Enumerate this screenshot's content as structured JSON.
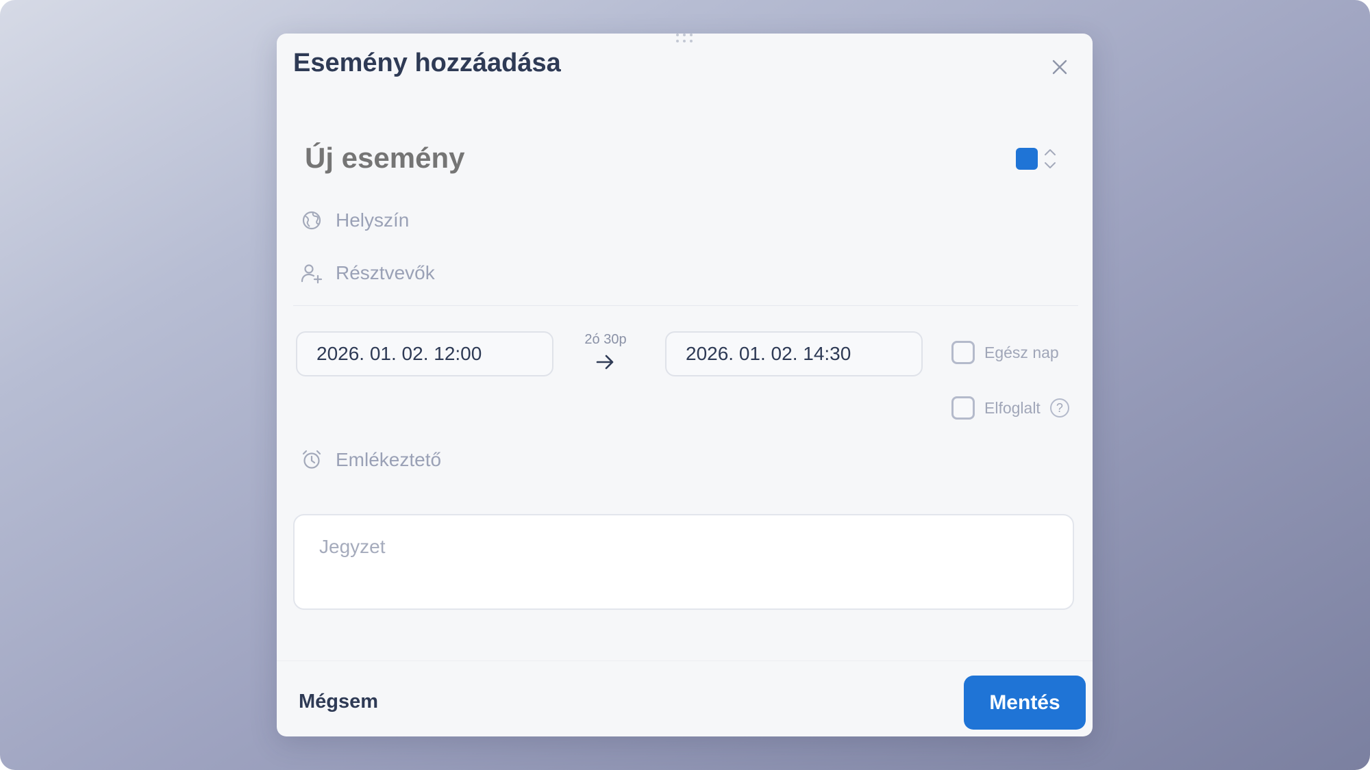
{
  "dialog": {
    "title": "Esemény hozzáadása",
    "event_name_placeholder": "Új esemény",
    "accent_color": "#1f74d6"
  },
  "fields": {
    "location_label": "Helyszín",
    "attendees_label": "Résztvevők",
    "reminder_label": "Emlékeztető",
    "note_placeholder": "Jegyzet"
  },
  "datetime": {
    "start": "2026. 01. 02. 12:00",
    "end": "2026. 01. 02. 14:30",
    "duration": "2ó 30p"
  },
  "options": {
    "all_day_label": "Egész nap",
    "busy_label": "Elfoglalt",
    "all_day_checked": false,
    "busy_checked": false
  },
  "footer": {
    "cancel_label": "Mégsem",
    "save_label": "Mentés"
  },
  "icons": [
    "drag-handle-icon",
    "close-icon",
    "chevron-updown-icon",
    "globe-icon",
    "user-plus-icon",
    "arrow-right-icon",
    "help-icon",
    "alarm-clock-icon"
  ]
}
